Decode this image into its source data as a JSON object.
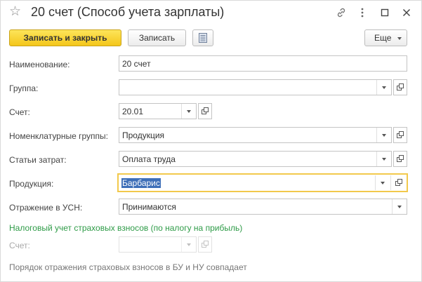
{
  "window": {
    "title": "20 счет (Способ учета зарплаты)",
    "icons": [
      "star-icon",
      "link-icon",
      "more-vertical-icon",
      "maximize-icon",
      "close-icon"
    ]
  },
  "toolbar": {
    "save_close_label": "Записать и закрыть",
    "save_label": "Записать",
    "more_label": "Еще"
  },
  "form": {
    "name": {
      "label": "Наименование:",
      "value": "20 счет"
    },
    "group": {
      "label": "Группа:",
      "value": ""
    },
    "account": {
      "label": "Счет:",
      "value": "20.01"
    },
    "nomenclature_groups": {
      "label": "Номенклатурные группы:",
      "value": "Продукция"
    },
    "cost_items": {
      "label": "Статьи затрат:",
      "value": "Оплата труда"
    },
    "product": {
      "label": "Продукция:",
      "value": "Барбарис"
    },
    "usn": {
      "label": "Отражение в УСН:",
      "value": "Принимаются"
    }
  },
  "insurance": {
    "heading": "Налоговый учет страховых взносов (по налогу на прибыль)",
    "account_label": "Счет:",
    "account_value": "",
    "note": "Порядок отражения страховых взносов в БУ и НУ совпадает"
  },
  "colors": {
    "primary_button": "#f4c61a",
    "focus_border": "#f2c94c",
    "section_heading": "#2e9b47",
    "selection": "#3e6fb8"
  }
}
